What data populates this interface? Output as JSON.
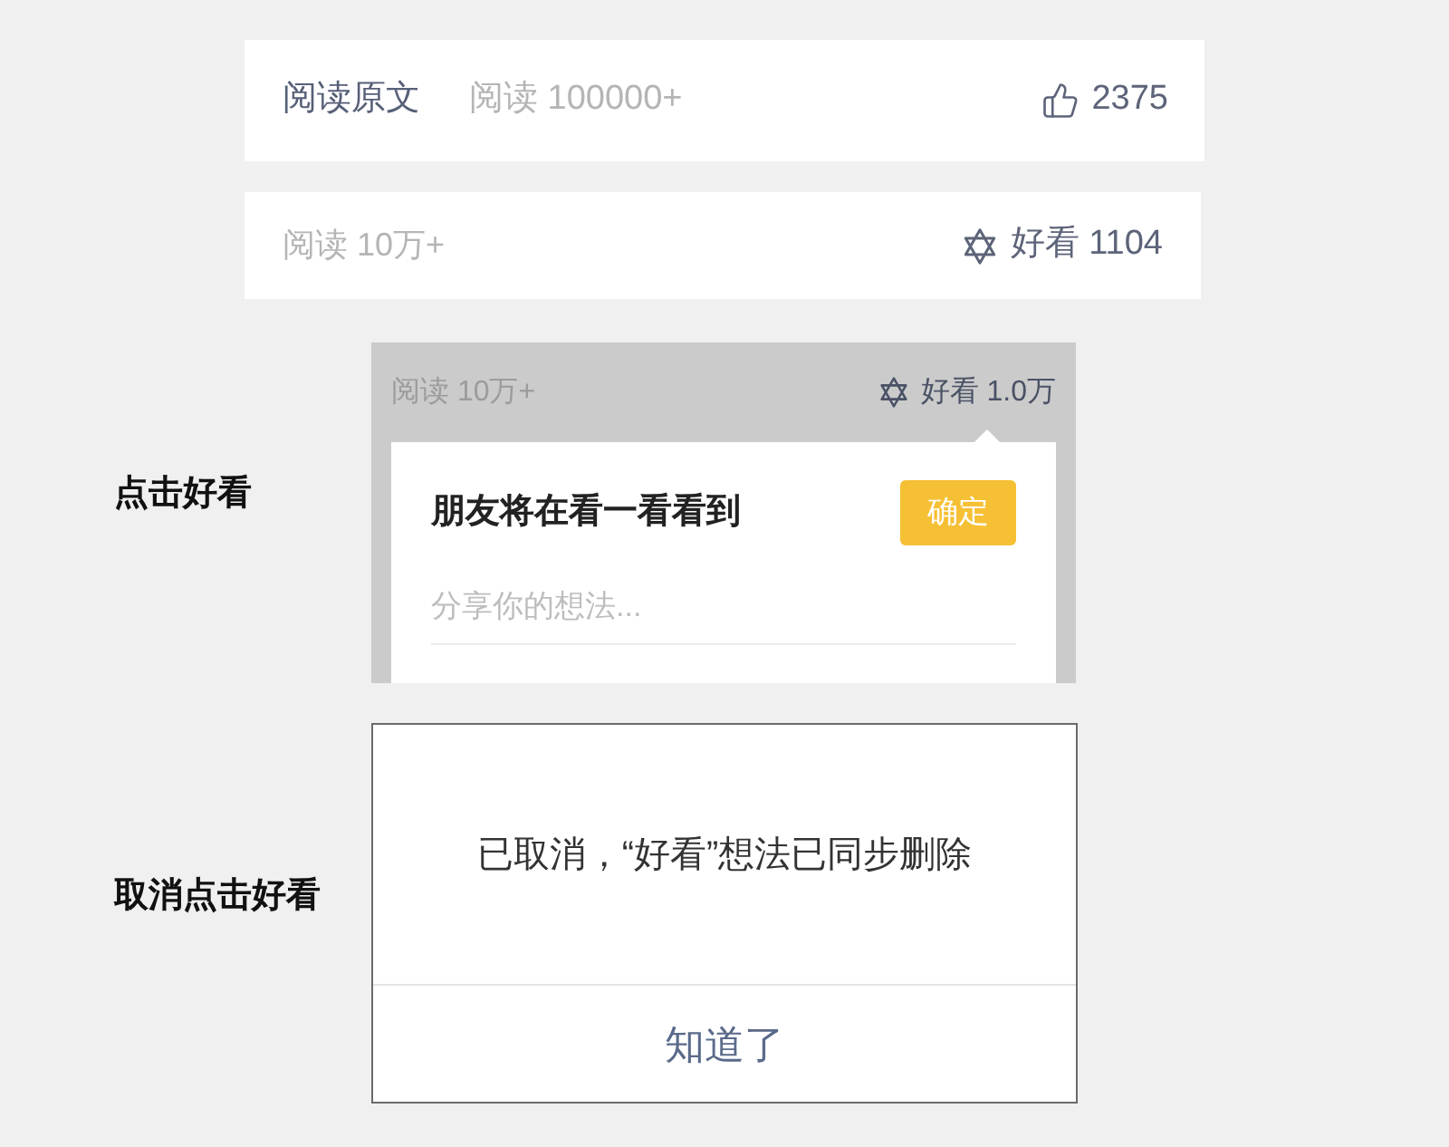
{
  "footers": [
    {
      "kind": "like",
      "link": "阅读原文",
      "reads": "阅读 100000+",
      "count": "2375"
    },
    {
      "kind": "wow",
      "reads": "阅读 10万+",
      "count": "好看 1104"
    }
  ],
  "steps": [
    {
      "kind": "popup",
      "caption": "点击好看",
      "reads": "阅读 10万+",
      "count": "好看 1.0万",
      "title": "朋友将在看一看看到",
      "confirm": "确定",
      "placeholder": "分享你的想法..."
    },
    {
      "kind": "dialog",
      "caption": "取消点击好看",
      "message": "已取消，“好看”想法已同步删除",
      "button": "知道了"
    }
  ]
}
